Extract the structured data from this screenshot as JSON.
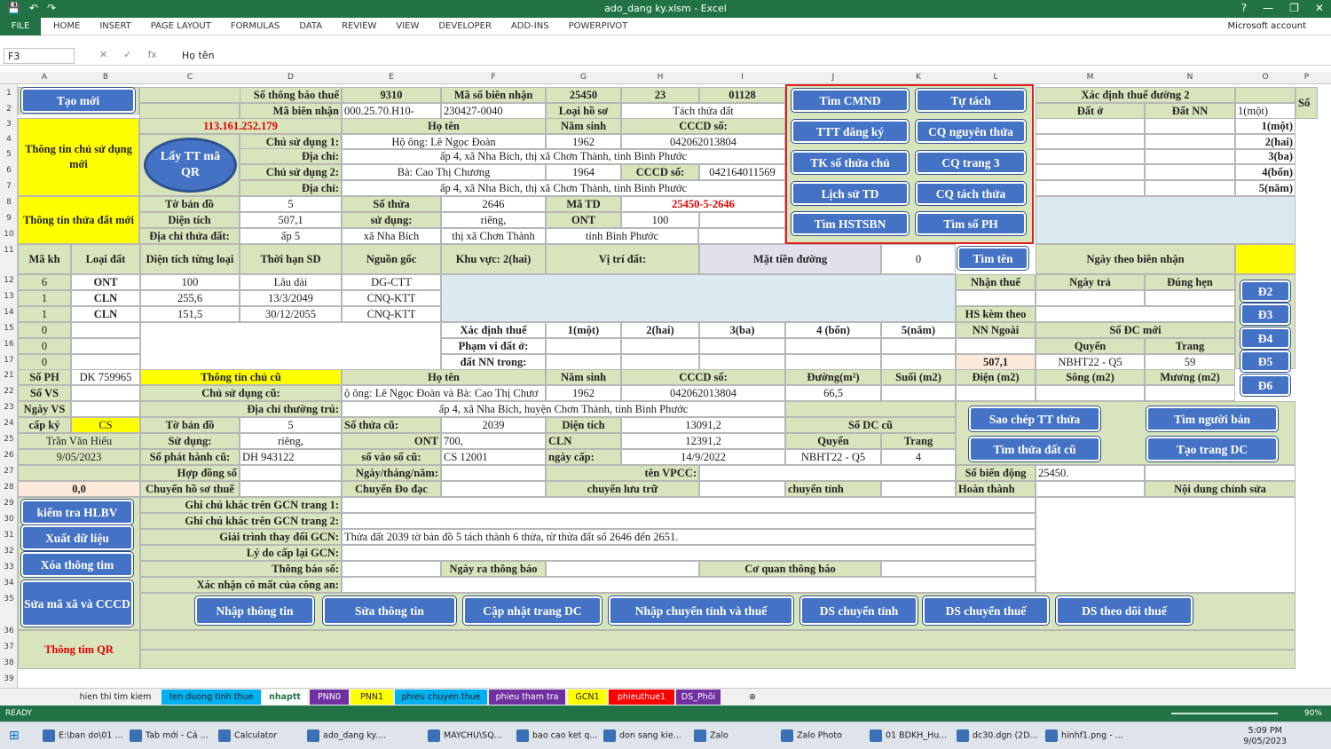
{
  "window": {
    "title": "ado_dang ky.xlsm - Excel",
    "help": "?",
    "min": "—",
    "restore": "❐",
    "close": "✕"
  },
  "ribbon": {
    "file": "FILE",
    "tabs": [
      "HOME",
      "INSERT",
      "PAGE LAYOUT",
      "FORMULAS",
      "DATA",
      "REVIEW",
      "VIEW",
      "DEVELOPER",
      "ADD-INS",
      "POWERPIVOT"
    ],
    "account": "Microsoft account"
  },
  "formula": {
    "namebox": "F3",
    "cancel": "✕",
    "enter": "✓",
    "fx": "fx",
    "value": "Họ tên"
  },
  "cols": [
    "A",
    "B",
    "C",
    "D",
    "E",
    "F",
    "G",
    "H",
    "I",
    "J",
    "K",
    "L",
    "M",
    "N",
    "O",
    "P"
  ],
  "rows": [
    "1",
    "2",
    "3",
    "4",
    "5",
    "6",
    "7",
    "8",
    "9",
    "10",
    "11",
    "12",
    "13",
    "14",
    "15",
    "16",
    "17",
    "21",
    "22",
    "23",
    "24",
    "25",
    "26",
    "27",
    "28",
    "29",
    "30",
    "31",
    "32",
    "33",
    "34",
    "35",
    "36",
    "37",
    "38",
    "39"
  ],
  "cells": {
    "so_tbt_lbl": "Số thông báo thuế",
    "so_tbt": "9310",
    "msbn_lbl": "Mã số biên nhận",
    "msbn": "25450",
    "h1": "23",
    "j1": "01128",
    "mbn_lbl": "Mã biên nhận",
    "mbn": "000.25.70.H10-",
    "mbn2": "230427-0040",
    "lhs_lbl": "Loại hồ sơ",
    "lhs": "Tách thửa đất",
    "ip": "113.161.252.179",
    "hoten": "Họ tên",
    "namsinh": "Năm sinh",
    "cccd": "CCCD số:",
    "csd1_lbl": "Chủ sử dụng 1:",
    "csd1": "Hộ ông: Lê Ngọc Đoàn",
    "ns1": "1962",
    "cccd1": "042062013804",
    "dc_lbl": "Địa chỉ:",
    "dc1": "ấp 4, xã Nha Bích, thị xã Chơn Thành, tỉnh Bình Phước",
    "csd2_lbl": "Chủ sử dụng 2:",
    "csd2": "Bà: Cao Thị Chương",
    "ns2": "1964",
    "cccd2_lbl": "CCCD số:",
    "cccd2": "042164011569",
    "dc2": "ấp 4, xã Nha Bích, thị xã Chơn Thành, tỉnh Bình Phước",
    "ttcsd": "Thông tin chủ sử dụng mới",
    "tttd": "Thông tin thửa đất mới",
    "tbd_lbl": "Tờ bản đồ",
    "tbd": "5",
    "st_lbl": "Số thửa",
    "st": "2646",
    "matd_lbl": "Mã TD",
    "matd": "25450-5-2646",
    "dtich_lbl": "Diện tích",
    "dtich": "507,1",
    "sd_lbl": "sử dụng:",
    "sd": "riêng,",
    "ont_lbl": "ONT",
    "ont": "100",
    "dctd_lbl": "Địa chỉ thửa đất:",
    "dctd": "ấp 5",
    "xa": "xã Nha Bích",
    "huyen": "thị xã Chơn Thành",
    "tinh": "tỉnh Bình Phước",
    "makh": "Mã kh",
    "loaidat": "Loại đất",
    "dttl": "Diện tích từng loại",
    "thsd": "Thời hạn SD",
    "nguongoc": "Nguồn gốc",
    "khuvuc": "Khu vực: 2(hai)",
    "vitri": "Vị trí đất:",
    "mattien": "Mặt tiền đường",
    "mattien_v": "0",
    "r12": [
      "6",
      "ONT",
      "100",
      "Lâu dài",
      "DG-CTT"
    ],
    "r13": [
      "1",
      "CLN",
      "255,6",
      "13/3/2049",
      "CNQ-KTT"
    ],
    "r14": [
      "1",
      "CLN",
      "151,5",
      "30/12/2055",
      "CNQ-KTT"
    ],
    "r15a": "0",
    "r16a": "0",
    "r17a": "0",
    "xdt": "Xác định thuế",
    "mot": "1(một)",
    "hai": "2(hai)",
    "ba": "3(ba)",
    "bon": "4 (bốn)",
    "nam": "5(năm)",
    "phamvi": "Phạm vi đất ở:",
    "datnn": "đất NN trong:",
    "soph_lbl": "Số PH",
    "soph": "DK 759965",
    "ttcc": "Thông tin chủ cũ",
    "hoten2": "Họ tên",
    "namsinh2": "Năm sinh",
    "cccd3": "CCCD số:",
    "duong": "Đường(m²)",
    "suoi": "Suối (m2)",
    "dien": "Điện (m2)",
    "song": "Sông (m2)",
    "muong": "Mương (m2)",
    "sovs": "Số VS",
    "csdc_lbl": "Chủ sử dụng cũ:",
    "csdc": "ộ ông: Lê Ngọc Đoàn và Bà: Cao Thị Chươ",
    "ns3": "1962",
    "cccd3v": "042062013804",
    "duong_v": "66,5",
    "ngayvs": "Ngày VS",
    "dctt_lbl": "Địa chỉ thường trú:",
    "dctt": "ấp 4, xã Nha Bích, huyện Chơn Thành, tỉnh Bình Phước",
    "capky": "cấp ký",
    "cs": "CS",
    "tbd2_lbl": "Tờ bản đồ",
    "tbd2": "5",
    "stc_lbl": "Số thửa cũ:",
    "stc": "2039",
    "dt2_lbl": "Diện tích",
    "dt2": "13091,2",
    "sodccu": "Số DC cũ",
    "tvh": "Trần Văn Hiếu",
    "sudung_lbl": "Sử dụng:",
    "sudung": "riêng,",
    "ont2_lbl": "ONT",
    "ont2": "700,",
    "cln_lbl": "CLN",
    "cln": "12391,2",
    "quyen_lbl": "Quyển",
    "trang_lbl": "Trang",
    "date": "9/05/2023",
    "sph_lbl": "Số phát hành cũ:",
    "sph": "DH 943122",
    "svs_lbl": "số vào sổ cũ:",
    "svs": "CS 12001",
    "nc_lbl": "ngày cấp:",
    "nc": "14/9/2022",
    "quyen": "NBHT22 - Q5",
    "trang": "4",
    "hds": "Hợp đồng số",
    "ntn": "Ngày/tháng/năm:",
    "vpcc": "tên VPCC:",
    "sbd_lbl": "Số biến động",
    "sbd": "25450.",
    "a28": "0,0",
    "chst": "Chuyển hồ sơ thuế",
    "cdd": "Chuyển Đo đạc",
    "clt": "chuyển lưu trữ",
    "ct": "chuyển tỉnh",
    "ht": "Hoàn thành",
    "ndcs": "Nội dung chỉnh sửa",
    "gc1": "Ghi chú khác trên GCN trang 1:",
    "gc2": "Ghi chú khác trên GCN trang 2:",
    "gt_lbl": "Giải trình thay đổi GCN:",
    "gt": "Thửa đất 2039 tờ bản đồ 5 tách thành 6 thửa, từ thửa đất số 2646 đến 2651.",
    "ld": "Lý do cấp lại GCN:",
    "tbs": "Thông báo số:",
    "nrtb": "Ngày ra thông báo",
    "cqtb": "Cơ quan thông báo",
    "xn": "Xác nhận có mất của công an:",
    "ttqr": "Thông tim QR",
    "xdt2": "Xác định thuế đường 2",
    "datio": "Đất ở",
    "datnn2": "Đất NN",
    "p2": "1(một)",
    "q2": "Số",
    "p3": "1(một)",
    "p4": "2(hai)",
    "p5": "3(ba)",
    "p6": "4(bốn)",
    "p7": "5(năm)",
    "ntbn": "Ngày theo biên nhận",
    "nhanthue": "Nhận thuế",
    "ngaytra": "Ngày trả",
    "dunghen": "Đúng hẹn",
    "hskt": "HS kèm theo",
    "nnngoai": "NN Ngoài",
    "sodcmoi": "Số ĐC mới",
    "quyen2": "Quyển",
    "trang2": "Trang",
    "m17": "507,1",
    "quyen2v": "NBHT22 - Q5",
    "trang2v": "59"
  },
  "buttons": {
    "taomoi": "Tạo mới",
    "laytt": "Lấy TT mã QR",
    "timcmnd": "Tìm CMND",
    "tutach": "Tự tách",
    "tttdk": "TTT đăng ký",
    "cqng": "CQ nguyên thửa",
    "tksothua": "TK số thửa chủ",
    "cqtrang3": "CQ trang 3",
    "lichsu": "Lịch sử TD",
    "cqtach": "CQ tách thửa",
    "timhs": "Tìm HSTSBN",
    "timsoph": "Tìm số PH",
    "timten": "Tìm tên",
    "d2": "Đ2",
    "d3": "Đ3",
    "d4": "Đ4",
    "d5": "Đ5",
    "d6": "Đ6",
    "saochep": "Sao chép TT thửa",
    "timnguoiban": "Tìm người bán",
    "timthuacu": "Tìm thửa đất cũ",
    "taotrangdc": "Tạo trang DC",
    "kiemtra": "kiểm tra HLBV",
    "xuat": "Xuất dữ liệu",
    "xoa": "Xóa thông tim",
    "suama": "Sửa mã xã và CCCD",
    "nhap": "Nhập thông tin",
    "sua": "Sửa thông tin",
    "capnhat": "Cập nhật trang DC",
    "nhapct": "Nhập chuyển tỉnh và thuế",
    "dsct": "DS chuyển tỉnh",
    "dsthue": "DS chuyển thuế",
    "dstd": "DS theo dõi thuế"
  },
  "sheets": [
    "hien thi tim kiem",
    "ten duong tinh thue",
    "nhaptt",
    "PNN0",
    "PNN1",
    "phieu chuyen thue",
    "phieu tham tra",
    "GCN1",
    "phieuthue1",
    "DS_Phôi"
  ],
  "sheet_colors": [
    "#f0f0f0",
    "#00b0f0",
    "#ffffff",
    "#7030a0",
    "#ffff00",
    "#00b0f0",
    "#7030a0",
    "#ffff00",
    "#ff0000",
    "#7030a0"
  ],
  "status": {
    "ready": "READY",
    "zoom": "90%"
  },
  "taskbar": [
    "E:\\ban do\\01 ...",
    "Tab mới - Cả ...",
    "Calculator",
    "ado_dang ky....",
    "MAYCHU\\SQ...",
    "bao cao ket q...",
    "don sang kie...",
    "Zalo",
    "Zalo Photo",
    "01 BDKH_Hu...",
    "dc30.dgn (2D...",
    "hinhf1.png - ..."
  ],
  "clock": {
    "time": "5:09 PM",
    "date": "9/05/2023"
  }
}
